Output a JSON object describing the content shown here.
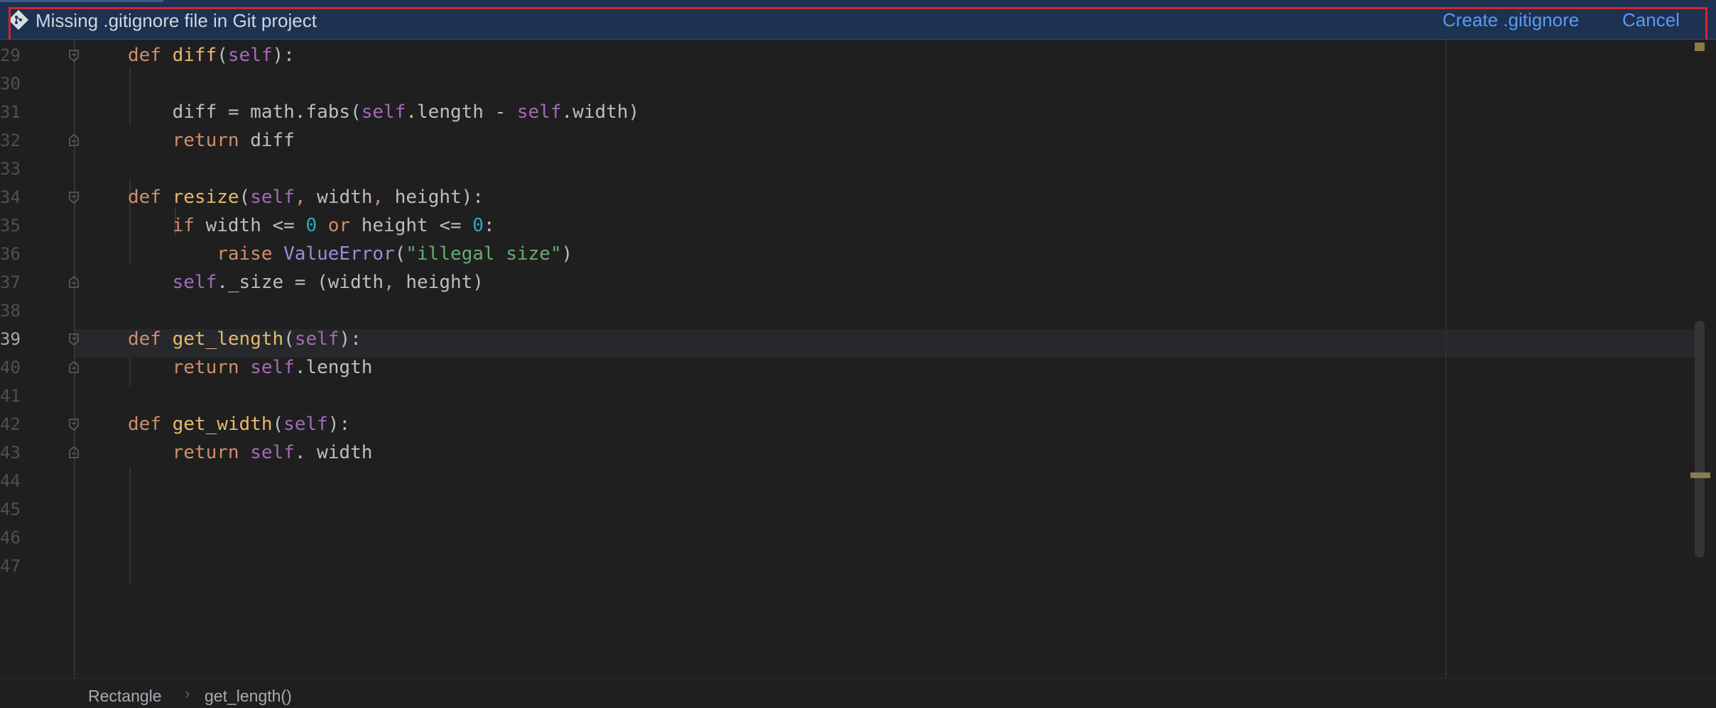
{
  "banner": {
    "icon": "git-icon",
    "message": "Missing .gitignore file in Git project",
    "create_label": "Create .gitignore",
    "cancel_label": "Cancel"
  },
  "editor": {
    "current_line": "39",
    "lines": [
      {
        "number": "29",
        "tokens": [
          [
            "kw",
            "def "
          ],
          [
            "fn",
            "diff"
          ],
          [
            "p",
            "("
          ],
          [
            "self",
            "self"
          ],
          [
            "p",
            "):"
          ]
        ]
      },
      {
        "number": "30",
        "tokens": []
      },
      {
        "number": "31",
        "tokens": [
          [
            "p",
            "    diff = math.fabs("
          ],
          [
            "self",
            "self"
          ],
          [
            "p",
            ".length - "
          ],
          [
            "self",
            "self"
          ],
          [
            "p",
            ".width)"
          ]
        ]
      },
      {
        "number": "32",
        "tokens": [
          [
            "kw",
            "    return "
          ],
          [
            "p",
            "diff"
          ]
        ]
      },
      {
        "number": "33",
        "tokens": []
      },
      {
        "number": "34",
        "tokens": [
          [
            "kw",
            "def "
          ],
          [
            "fn",
            "resize"
          ],
          [
            "p",
            "("
          ],
          [
            "self",
            "self"
          ],
          [
            "kw",
            ", "
          ],
          [
            "p",
            "width"
          ],
          [
            "kw",
            ", "
          ],
          [
            "p",
            "height):"
          ]
        ]
      },
      {
        "number": "35",
        "tokens": [
          [
            "kw",
            "    if "
          ],
          [
            "p",
            "width <= "
          ],
          [
            "num",
            "0"
          ],
          [
            "kw",
            " or "
          ],
          [
            "p",
            "height <= "
          ],
          [
            "num",
            "0"
          ],
          [
            "p",
            ":"
          ]
        ]
      },
      {
        "number": "36",
        "tokens": [
          [
            "kw",
            "        raise "
          ],
          [
            "cls",
            "ValueError"
          ],
          [
            "p",
            "("
          ],
          [
            "str",
            "\"illegal size\""
          ],
          [
            "p",
            ")"
          ]
        ]
      },
      {
        "number": "37",
        "tokens": [
          [
            "self",
            "    self"
          ],
          [
            "p",
            "._size = (width"
          ],
          [
            "kw",
            ", "
          ],
          [
            "p",
            "height)"
          ]
        ]
      },
      {
        "number": "38",
        "tokens": []
      },
      {
        "number": "39",
        "tokens": [
          [
            "kw",
            "def "
          ],
          [
            "fn",
            "get_length"
          ],
          [
            "p",
            "("
          ],
          [
            "self",
            "self"
          ],
          [
            "p",
            "):"
          ]
        ]
      },
      {
        "number": "40",
        "tokens": [
          [
            "kw",
            "    return "
          ],
          [
            "self",
            "self"
          ],
          [
            "p",
            ".length"
          ]
        ]
      },
      {
        "number": "41",
        "tokens": []
      },
      {
        "number": "42",
        "tokens": [
          [
            "kw",
            "def "
          ],
          [
            "fn",
            "get_width"
          ],
          [
            "p",
            "("
          ],
          [
            "self",
            "self"
          ],
          [
            "p",
            "):"
          ]
        ]
      },
      {
        "number": "43",
        "tokens": [
          [
            "kw",
            "    return "
          ],
          [
            "self",
            "self"
          ],
          [
            "p",
            ". width"
          ]
        ]
      },
      {
        "number": "44",
        "tokens": []
      },
      {
        "number": "45",
        "tokens": []
      },
      {
        "number": "46",
        "tokens": []
      },
      {
        "number": "47",
        "tokens": []
      }
    ]
  },
  "breadcrumb": {
    "items": [
      "Rectangle",
      "get_length()"
    ],
    "separator": "›"
  },
  "colors": {
    "banner_bg": "#1d3150",
    "highlight_outline": "#d5232f",
    "link": "#5a9bf0",
    "keyword": "#cf8e6d",
    "function": "#e8b86a",
    "self": "#a56ab6",
    "number": "#2aacb8",
    "string": "#6aab73"
  }
}
